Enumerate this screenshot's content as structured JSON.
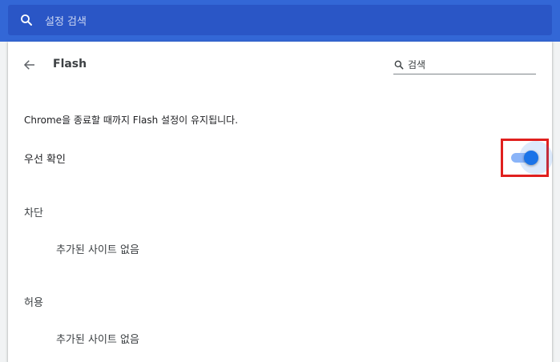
{
  "top_search": {
    "placeholder": "설정 검색"
  },
  "header": {
    "title": "Flash",
    "search_placeholder": "검색"
  },
  "main": {
    "info": "Chrome을 종료할 때까지 Flash 설정이 유지됩니다.",
    "ask_first": {
      "label": "우선 확인",
      "enabled": true
    },
    "block": {
      "heading": "차단",
      "empty": "추가된 사이트 없음"
    },
    "allow": {
      "heading": "허용",
      "empty": "추가된 사이트 없음"
    }
  },
  "colors": {
    "topbar": "#3367d6",
    "toggle_accent": "#1a73e8",
    "highlight": "#e0201e"
  }
}
